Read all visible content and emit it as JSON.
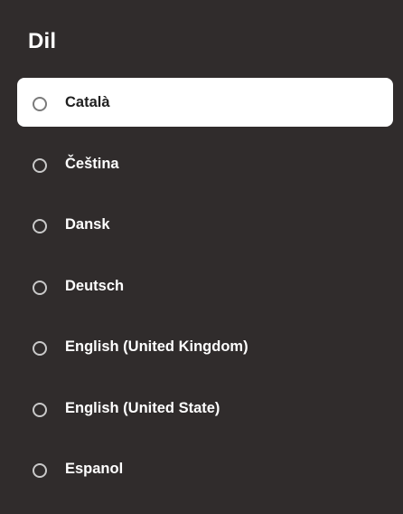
{
  "header": {
    "title": "Dil"
  },
  "options": [
    {
      "label": "Català",
      "selected": true
    },
    {
      "label": "Čeština",
      "selected": false
    },
    {
      "label": "Dansk",
      "selected": false
    },
    {
      "label": "Deutsch",
      "selected": false
    },
    {
      "label": "English (United Kingdom)",
      "selected": false
    },
    {
      "label": "English (United State)",
      "selected": false
    },
    {
      "label": "Espanol",
      "selected": false
    }
  ],
  "colors": {
    "background": "#302c2c",
    "focus_background": "#ffffff",
    "text": "#ffffff",
    "focus_text": "#1f1f1f",
    "radio": "#c9c9c9"
  }
}
